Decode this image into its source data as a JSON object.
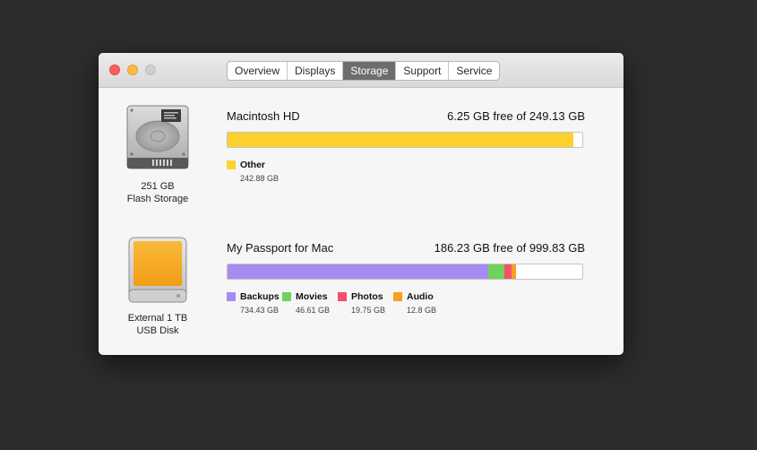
{
  "tabs": [
    {
      "label": "Overview",
      "active": false
    },
    {
      "label": "Displays",
      "active": false
    },
    {
      "label": "Storage",
      "active": true
    },
    {
      "label": "Support",
      "active": false
    },
    {
      "label": "Service",
      "active": false
    }
  ],
  "drives": [
    {
      "icon": "internal-hard-drive-icon",
      "caption_line1": "251 GB",
      "caption_line2": "Flash Storage",
      "name": "Macintosh HD",
      "free_text": "6.25 GB free of 249.13 GB",
      "total_gb": 249.13,
      "segments": [
        {
          "label": "Other",
          "value": "242.88 GB",
          "gb": 242.88,
          "color": "#fdd22f"
        }
      ]
    },
    {
      "icon": "external-usb-disk-icon",
      "caption_line1": "External 1 TB",
      "caption_line2": "USB Disk",
      "name": "My Passport for Mac",
      "free_text": "186.23 GB free of 999.83 GB",
      "total_gb": 999.83,
      "segments": [
        {
          "label": "Backups",
          "value": "734.43 GB",
          "gb": 734.43,
          "color": "#a68bf3"
        },
        {
          "label": "Movies",
          "value": "46.61 GB",
          "gb": 46.61,
          "color": "#6fd35a"
        },
        {
          "label": "Photos",
          "value": "19.75 GB",
          "gb": 19.75,
          "color": "#f2506a"
        },
        {
          "label": "Audio",
          "value": "12.8 GB",
          "gb": 12.8,
          "color": "#f6a022"
        }
      ]
    }
  ]
}
